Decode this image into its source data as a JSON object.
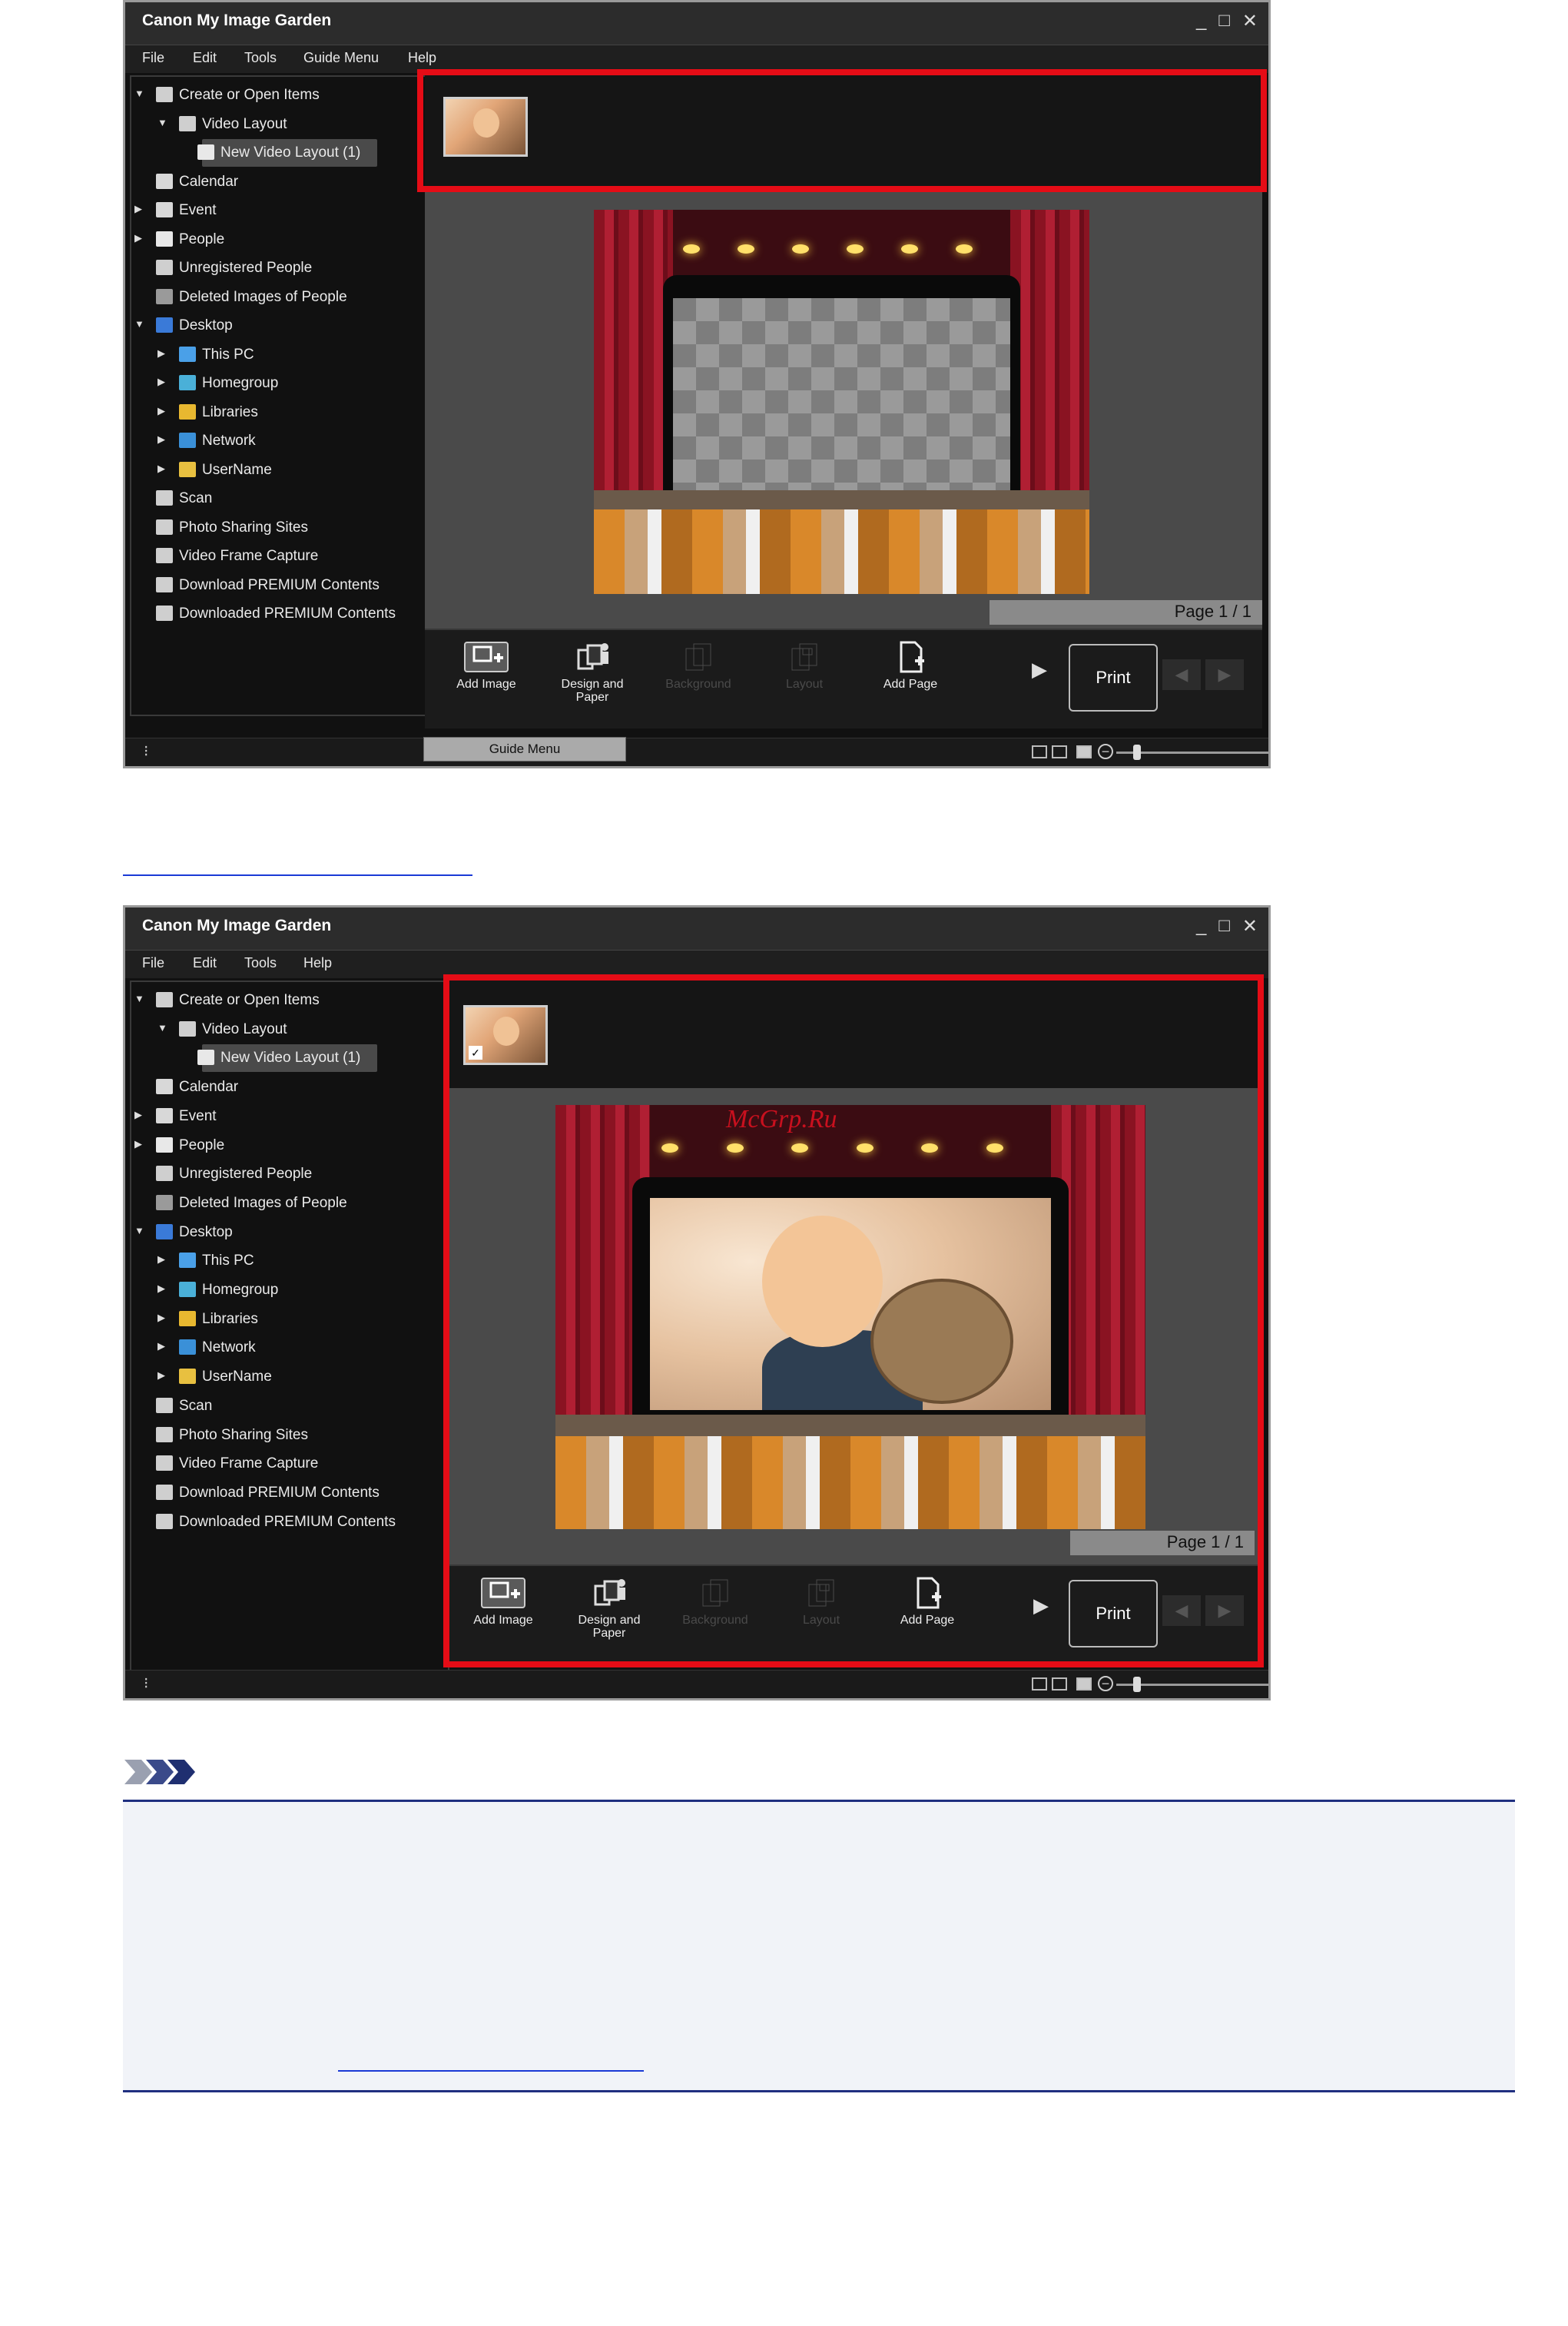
{
  "app": {
    "title": "Canon My Image Garden",
    "min_glyph": "_",
    "max_glyph": "□",
    "close_glyph": "✕"
  },
  "menus": {
    "shot1": [
      "File",
      "Edit",
      "Tools",
      "Guide Menu",
      "Help"
    ],
    "shot2": [
      "File",
      "Edit",
      "Tools",
      "Help"
    ]
  },
  "tree": [
    {
      "label": "Create or Open Items",
      "level": 0,
      "arrow": "▼",
      "icon": "create-icon"
    },
    {
      "label": "Video Layout",
      "level": 1,
      "arrow": "▼",
      "icon": "video-layout-icon"
    },
    {
      "label": "New Video Layout (1)",
      "level": 2,
      "arrow": "",
      "icon": "layout-doc-icon",
      "selected": true
    },
    {
      "label": "Calendar",
      "level": 0,
      "arrow": "",
      "icon": "calendar-icon"
    },
    {
      "label": "Event",
      "level": 0,
      "arrow": "▶",
      "icon": "event-icon"
    },
    {
      "label": "People",
      "level": 0,
      "arrow": "▶",
      "icon": "people-icon"
    },
    {
      "label": "Unregistered People",
      "level": 0,
      "arrow": "",
      "icon": "unregistered-people-icon"
    },
    {
      "label": "Deleted Images of People",
      "level": 0,
      "arrow": "",
      "icon": "deleted-people-icon"
    },
    {
      "label": "Desktop",
      "level": 0,
      "arrow": "▼",
      "icon": "desktop-icon"
    },
    {
      "label": "This PC",
      "level": 1,
      "arrow": "▶",
      "icon": "this-pc-icon"
    },
    {
      "label": "Homegroup",
      "level": 1,
      "arrow": "▶",
      "icon": "homegroup-icon"
    },
    {
      "label": "Libraries",
      "level": 1,
      "arrow": "▶",
      "icon": "libraries-icon"
    },
    {
      "label": "Network",
      "level": 1,
      "arrow": "▶",
      "icon": "network-icon"
    },
    {
      "label": "UserName",
      "level": 1,
      "arrow": "▶",
      "icon": "user-folder-icon"
    },
    {
      "label": "Scan",
      "level": 0,
      "arrow": "",
      "icon": "scan-icon"
    },
    {
      "label": "Photo Sharing Sites",
      "level": 0,
      "arrow": "",
      "icon": "photo-sharing-icon"
    },
    {
      "label": "Video Frame Capture",
      "level": 0,
      "arrow": "",
      "icon": "video-frame-icon"
    },
    {
      "label": "Download PREMIUM Contents",
      "level": 0,
      "arrow": "",
      "icon": "download-premium-icon"
    },
    {
      "label": "Downloaded PREMIUM Contents",
      "level": 0,
      "arrow": "",
      "icon": "downloaded-premium-icon"
    }
  ],
  "page_indicator": "Page 1 / 1",
  "toolbar": {
    "add_image": "Add Image",
    "design_paper": "Design and Paper",
    "background": "Background",
    "layout": "Layout",
    "add_page": "Add Page",
    "print": "Print"
  },
  "guide_menu_button": "Guide Menu",
  "watermark": "McGrp.Ru",
  "colors": {
    "highlight": "#e50c16",
    "link": "#1a3ad6",
    "note_rule": "#1f2f80"
  }
}
